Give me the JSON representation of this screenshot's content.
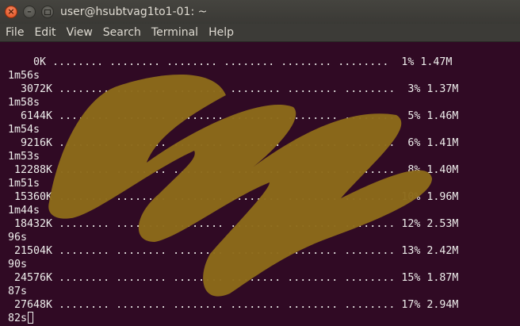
{
  "window": {
    "title": "user@hsubtvag1to1-01: ~",
    "buttons": {
      "close_glyph": "×",
      "min_glyph": "–"
    }
  },
  "menu": [
    "File",
    "Edit",
    "View",
    "Search",
    "Terminal",
    "Help"
  ],
  "terminal": {
    "lines": [
      "    0K ........ ........ ........ ........ ........ ........  1% 1.47M",
      "1m56s",
      "  3072K ........ ........ ........ ........ ........ ........  3% 1.37M",
      "1m58s",
      "  6144K ........ ........ ........ ........ ........ ........  5% 1.46M",
      "1m54s",
      "  9216K ........ ........ ........ ........ ........ ........  6% 1.41M",
      "1m53s",
      " 12288K ........ ........ ........ ........ ........ ........  8% 1.40M",
      "1m51s",
      " 15360K ........ ........ ........ ........ ........ ........ 10% 1.96M",
      "1m44s",
      " 18432K ........ ........ ........ ........ ........ ........ 12% 2.53M",
      "96s",
      " 21504K ........ ........ ........ ........ ........ ........ 13% 2.42M",
      "90s",
      " 24576K ........ ........ ........ ........ ........ ........ 15% 1.87M",
      "87s",
      " 27648K ........ ........ ........ ........ ........ ........ 17% 2.94M",
      "82s"
    ]
  },
  "colors": {
    "background": "#300a24",
    "text": "#eeeeec",
    "scribble": "#8c6a1a"
  }
}
